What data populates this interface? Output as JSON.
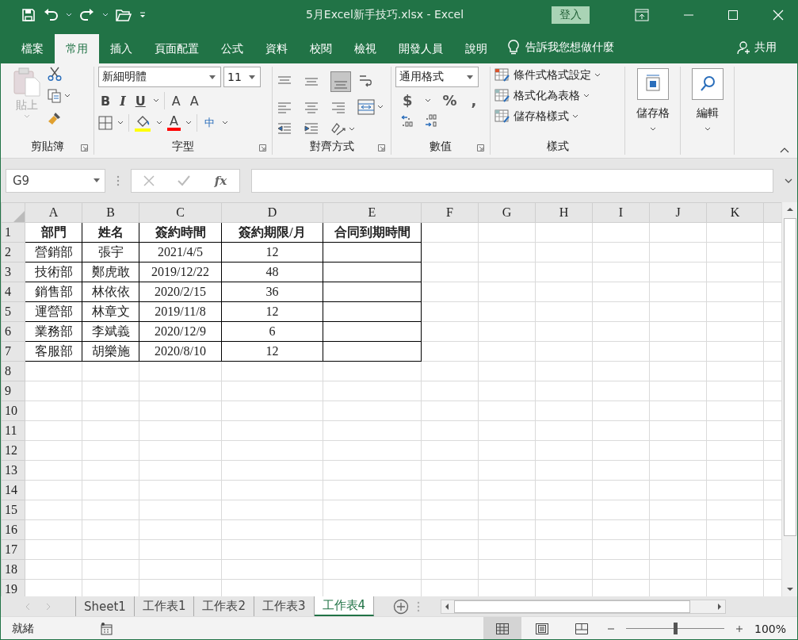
{
  "window": {
    "title": "5月Excel新手技巧.xlsx  -  Excel",
    "sign_in": "登入"
  },
  "ribbon_tabs": [
    {
      "label": "檔案",
      "selected": false
    },
    {
      "label": "常用",
      "selected": true
    },
    {
      "label": "插入",
      "selected": false
    },
    {
      "label": "頁面配置",
      "selected": false
    },
    {
      "label": "公式",
      "selected": false
    },
    {
      "label": "資料",
      "selected": false
    },
    {
      "label": "校閱",
      "selected": false
    },
    {
      "label": "檢視",
      "selected": false
    },
    {
      "label": "開發人員",
      "selected": false
    },
    {
      "label": "說明",
      "selected": false
    }
  ],
  "tell_me": "告訴我您想做什麼",
  "share": "共用",
  "clipboard": {
    "paste": "貼上",
    "label": "剪貼簿"
  },
  "font": {
    "name": "新細明體",
    "size": "11",
    "bold": "B",
    "italic": "I",
    "underline": "U",
    "grow": "A",
    "shrink": "A",
    "font_color": "A",
    "phonetic": "中",
    "label": "字型"
  },
  "alignment": {
    "label": "對齊方式"
  },
  "number": {
    "format": "通用格式",
    "currency": "$",
    "percent": "%",
    "comma": ",",
    "label": "數值"
  },
  "styles": {
    "items": [
      "條件式格式設定",
      "格式化為表格",
      "儲存格樣式"
    ],
    "label": "樣式"
  },
  "cells_group": {
    "label": "儲存格"
  },
  "editing": {
    "label": "編輯"
  },
  "formula_bar": {
    "name_box": "G9",
    "fx": "fx"
  },
  "sheet": {
    "columns": [
      "A",
      "B",
      "C",
      "D",
      "E",
      "F",
      "G",
      "H",
      "I",
      "J",
      "K"
    ],
    "row_numbers": [
      "1",
      "2",
      "3",
      "4",
      "5",
      "6",
      "7",
      "8",
      "9",
      "10",
      "11",
      "12",
      "13",
      "14",
      "15",
      "16",
      "17",
      "18",
      "19"
    ],
    "header": [
      "部門",
      "姓名",
      "簽約時間",
      "簽約期限/月",
      "合同到期時間"
    ],
    "rows": [
      [
        "營銷部",
        "張宇",
        "2021/4/5",
        "12"
      ],
      [
        "技術部",
        "鄭虎敢",
        "2019/12/22",
        "48"
      ],
      [
        "銷售部",
        "林依依",
        "2020/2/15",
        "36"
      ],
      [
        "運營部",
        "林章文",
        "2019/11/8",
        "12"
      ],
      [
        "業務部",
        "李斌義",
        "2020/12/9",
        "6"
      ],
      [
        "客服部",
        "胡樂施",
        "2020/8/10",
        "12"
      ]
    ]
  },
  "sheet_tabs": [
    {
      "label": "Sheet1",
      "selected": false
    },
    {
      "label": "工作表1",
      "selected": false
    },
    {
      "label": "工作表2",
      "selected": false
    },
    {
      "label": "工作表3",
      "selected": false
    },
    {
      "label": "工作表4",
      "selected": true
    }
  ],
  "status": {
    "text": "就緒",
    "zoom": "100%",
    "zoom_slider": {
      "level": 0.5
    },
    "views": [
      {
        "kind": "normal",
        "selected": true
      },
      {
        "kind": "page_layout",
        "selected": false
      },
      {
        "kind": "page_break",
        "selected": false
      }
    ]
  }
}
